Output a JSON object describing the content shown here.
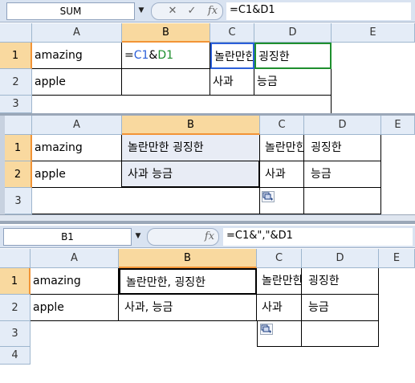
{
  "panel1": {
    "name_box": "SUM",
    "formula": "=C1&D1",
    "columns": [
      "A",
      "B",
      "C",
      "D",
      "E"
    ],
    "rows": [
      "1",
      "2",
      "3"
    ],
    "cells": {
      "a1": "amazing",
      "b1_prefix": "=",
      "b1_ref1": "C1",
      "b1_amp": "&",
      "b1_ref2": "D1",
      "c1": "놀란만한",
      "d1": "굉징한",
      "a2": "apple",
      "c2": "사과",
      "d2": "능금"
    },
    "ref_colors": {
      "c1": "#2b5fd9",
      "d1": "#1e8f2e"
    }
  },
  "panel2": {
    "columns": [
      "A",
      "B",
      "C",
      "D",
      "E"
    ],
    "rows": [
      "1",
      "2",
      "3"
    ],
    "cells": {
      "a1": "amazing",
      "b1": "놀란만한 굉징한",
      "c1": "놀란만한",
      "d1": "굉징한",
      "a2": "apple",
      "b2": "사과 능금",
      "c2": "사과",
      "d2": "능금"
    }
  },
  "panel3": {
    "name_box": "B1",
    "formula": "=C1&\",\"&D1",
    "columns": [
      "A",
      "B",
      "C",
      "D",
      "E"
    ],
    "rows": [
      "1",
      "2",
      "3",
      "4"
    ],
    "cells": {
      "a1": "amazing",
      "b1": "놀란만한, 굉징한",
      "c1": "놀란만한",
      "d1": "굉징한",
      "a2": "apple",
      "b2": "사과, 능금",
      "c2": "사과",
      "d2": "능금"
    }
  },
  "icons": {
    "fx": "fx",
    "cancel": "✕",
    "enter": "✓",
    "dropdown": "▼",
    "paste_options": "paste-options-icon"
  }
}
